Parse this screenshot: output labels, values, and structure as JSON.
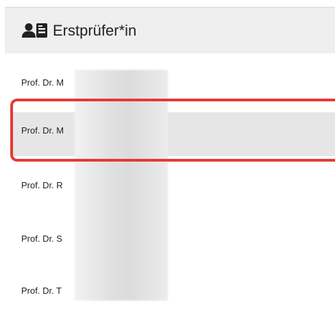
{
  "header": {
    "title": "Erstprüfer*in",
    "icon": "user-card-icon"
  },
  "list": {
    "items": [
      {
        "label": "Prof. Dr. M",
        "selected": false
      },
      {
        "label": "Prof. Dr. M",
        "selected": true
      },
      {
        "label": "Prof. Dr. R",
        "selected": false
      },
      {
        "label": "Prof. Dr. S",
        "selected": false
      },
      {
        "label": "Prof. Dr. T",
        "selected": false
      }
    ]
  },
  "colors": {
    "header_bg": "#efefef",
    "selected_bg": "#e6e6e6",
    "highlight_border": "#e53935"
  }
}
